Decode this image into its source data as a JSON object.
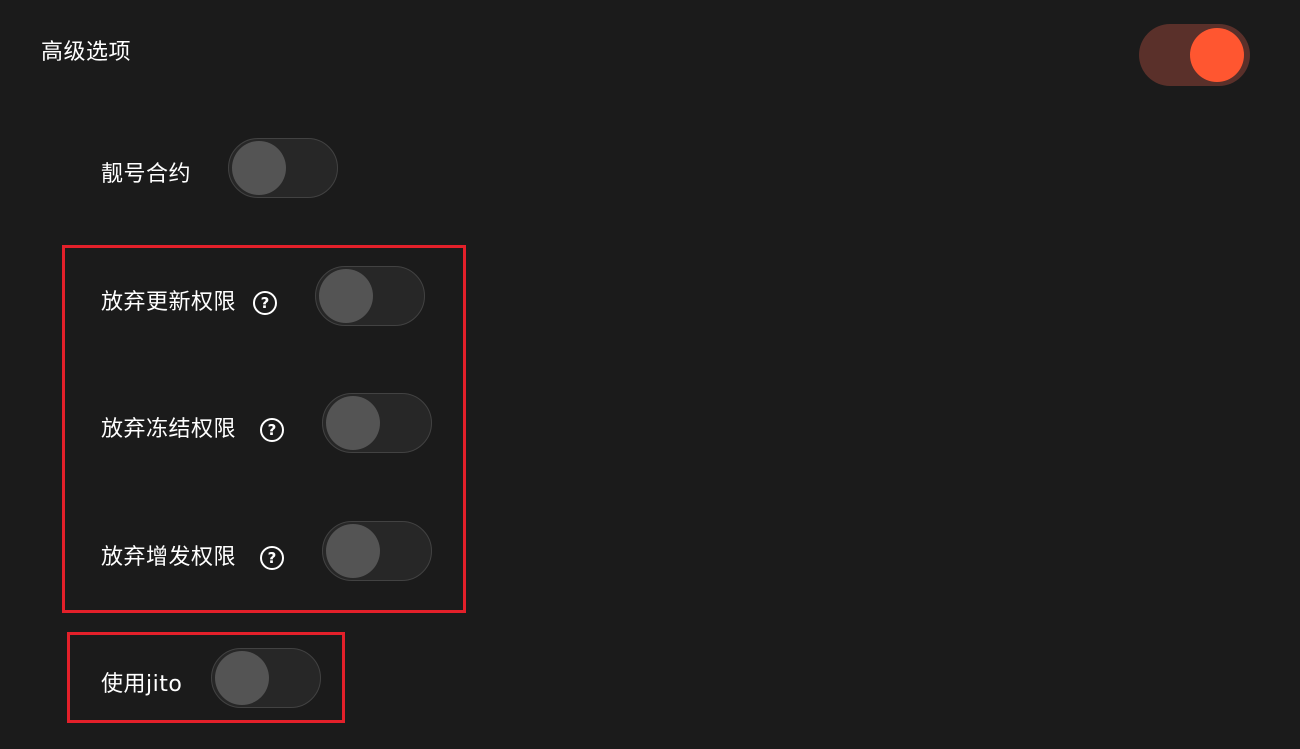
{
  "header": {
    "title": "高级选项",
    "advanced_toggle_on": true
  },
  "options": [
    {
      "label": "靓号合约",
      "on": false,
      "has_help": false
    },
    {
      "label": "放弃更新权限",
      "on": false,
      "has_help": true,
      "help_icon": "question-circle-icon"
    },
    {
      "label": "放弃冻结权限",
      "on": false,
      "has_help": true,
      "help_icon": "question-circle-icon"
    },
    {
      "label": "放弃增发权限",
      "on": false,
      "has_help": true,
      "help_icon": "question-circle-icon"
    },
    {
      "label": "使用jito",
      "on": false,
      "has_help": false
    }
  ],
  "help_glyph": "?",
  "colors": {
    "background": "#1b1b1b",
    "toggle_on_track": "#5a302a",
    "toggle_on_knob": "#ff5630",
    "toggle_off_track": "#272727",
    "toggle_off_knob": "#545454",
    "highlight": "#e3202a"
  }
}
